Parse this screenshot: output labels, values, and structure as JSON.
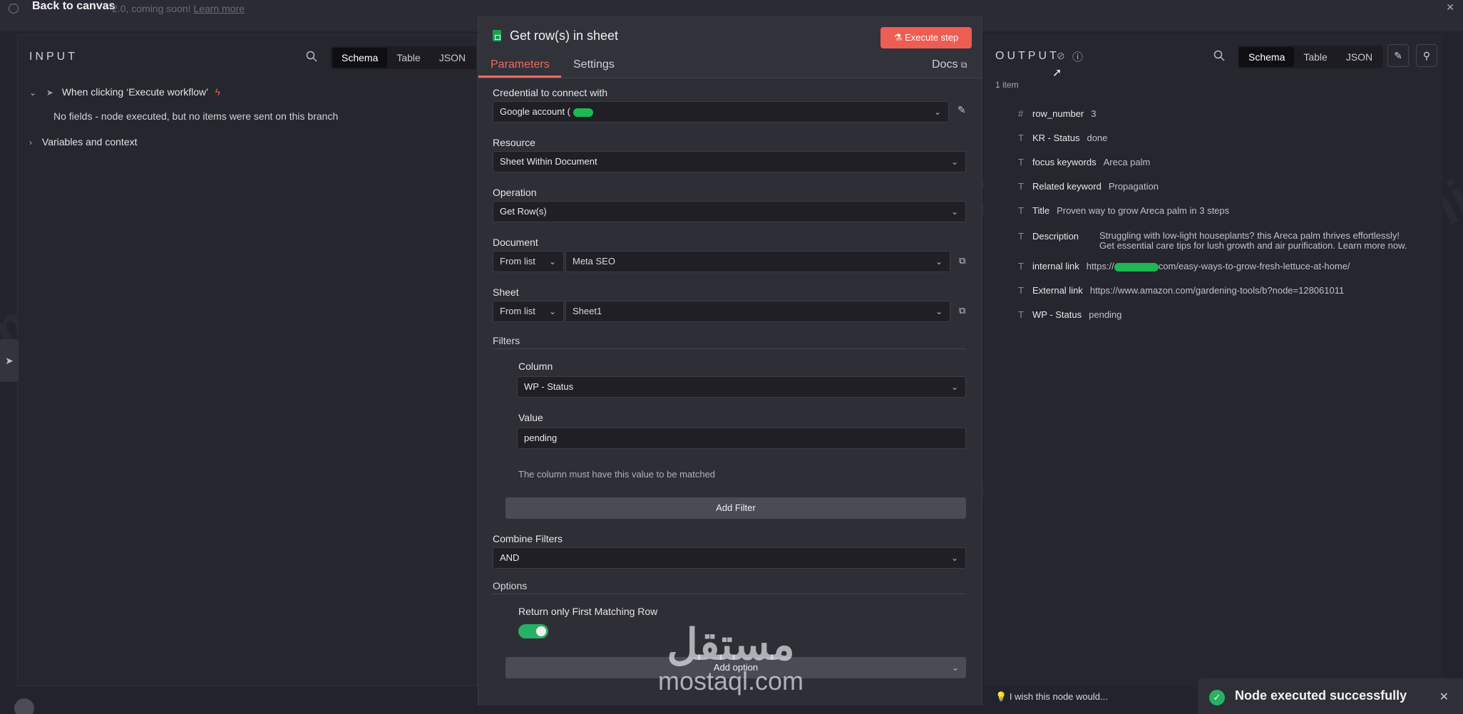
{
  "topbar": {
    "back_label": "Back to canvas",
    "coming_text": "2.0, coming soon!",
    "learn_more": "Learn more"
  },
  "input_panel": {
    "title": "INPUT",
    "tabs": [
      "Schema",
      "Table",
      "JSON"
    ],
    "trigger": "When clicking ‘Execute workflow’",
    "no_fields": "No fields - node executed, but no items were sent on this branch",
    "variables": "Variables and context"
  },
  "dialog": {
    "title": "Get row(s) in sheet",
    "execute_label": "Execute step",
    "tab_parameters": "Parameters",
    "tab_settings": "Settings",
    "docs": "Docs",
    "credential_label": "Credential to connect with",
    "credential_value": "Google account (",
    "resource_label": "Resource",
    "resource_value": "Sheet Within Document",
    "operation_label": "Operation",
    "operation_value": "Get Row(s)",
    "document_label": "Document",
    "document_mode": "From list",
    "document_value": "Meta SEO",
    "sheet_label": "Sheet",
    "sheet_mode": "From list",
    "sheet_value": "Sheet1",
    "filters_label": "Filters",
    "column_label": "Column",
    "column_value": "WP - Status",
    "value_label": "Value",
    "value_value": "pending",
    "value_hint": "The column must have this value to be matched",
    "add_filter": "Add Filter",
    "combine_label": "Combine Filters",
    "combine_value": "AND",
    "options_label": "Options",
    "first_match_label": "Return only First Matching Row",
    "first_match_on": true,
    "add_option": "Add option"
  },
  "output_panel": {
    "title": "OUTPUT",
    "tabs": [
      "Schema",
      "Table",
      "JSON"
    ],
    "count": "1 item",
    "rows": [
      {
        "type": "#",
        "key": "row_number",
        "value": "3"
      },
      {
        "type": "T",
        "key": "KR - Status",
        "value": "done"
      },
      {
        "type": "T",
        "key": "focus keywords",
        "value": "Areca palm"
      },
      {
        "type": "T",
        "key": "Related keyword",
        "value": "Propagation"
      },
      {
        "type": "T",
        "key": "Title",
        "value": "Proven way to grow Areca palm in 3 steps"
      },
      {
        "type": "T",
        "key": "Description",
        "value": "Struggling with low-light houseplants? this Areca palm thrives effortlessly!",
        "value2": "Get essential care tips for lush growth and air purification. Learn more now."
      },
      {
        "type": "T",
        "key": "internal link",
        "value_pre": "https://",
        "value": "com/easy-ways-to-grow-fresh-lettuce-at-home/"
      },
      {
        "type": "T",
        "key": "External link",
        "value": "https://www.amazon.com/gardening-tools/b?node=128061011"
      },
      {
        "type": "T",
        "key": "WP - Status",
        "value": "pending"
      }
    ]
  },
  "bottom": {
    "wish": "I wish this node would...",
    "toast": "Node executed successfully"
  },
  "watermark": {
    "text": "mohmaed amin",
    "logo_ar": "مستقل",
    "logo_en": "mostaql.com"
  },
  "colors": {
    "accent": "#ee6b5f",
    "execute": "#ee5d54",
    "success": "#27b164"
  }
}
